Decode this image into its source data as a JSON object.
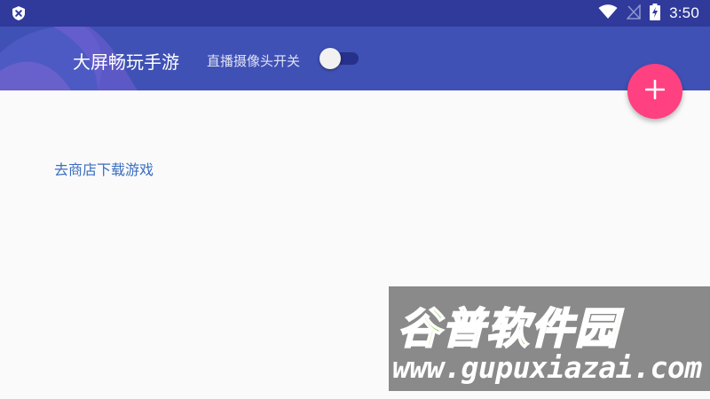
{
  "status_bar": {
    "time": "3:50",
    "icons": [
      "shield-x-icon",
      "wifi-icon",
      "no-signal-icon",
      "battery-charging-icon"
    ]
  },
  "app_bar": {
    "title": "大屏畅玩手游",
    "camera_switch_label": "直播摄像头开关",
    "camera_switch_state": "off"
  },
  "fab": {
    "icon": "plus-icon"
  },
  "main": {
    "store_link": "去商店下载游戏"
  },
  "watermark": {
    "title": "谷普软件园",
    "url": "www.gupuxiazai.com"
  },
  "colors": {
    "status_bar": "#2f3a9a",
    "app_bar": "#3f51b5",
    "fab": "#ff4081",
    "link": "#3a6ec0",
    "background": "#fafafa"
  }
}
